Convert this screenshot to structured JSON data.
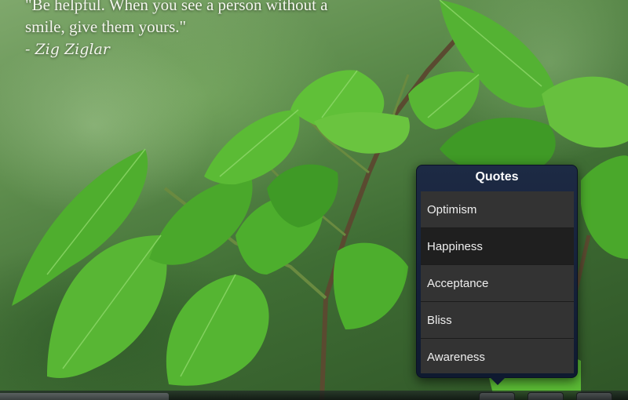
{
  "quote": {
    "text": "\"Be helpful. When you see a person without a smile, give them yours.\"",
    "author": "- Zig Ziglar"
  },
  "popover": {
    "title": "Quotes",
    "items": [
      {
        "label": "Optimism",
        "selected": false
      },
      {
        "label": "Happiness",
        "selected": true
      },
      {
        "label": "Acceptance",
        "selected": false
      },
      {
        "label": "Bliss",
        "selected": false
      },
      {
        "label": "Awareness",
        "selected": false
      }
    ]
  },
  "colors": {
    "popover_header": "#1d2a44",
    "row_bg": "#333333",
    "row_selected_bg": "#1f1f1f",
    "row_text": "#eeeeee"
  },
  "background": {
    "icon": "leaf-photo"
  }
}
